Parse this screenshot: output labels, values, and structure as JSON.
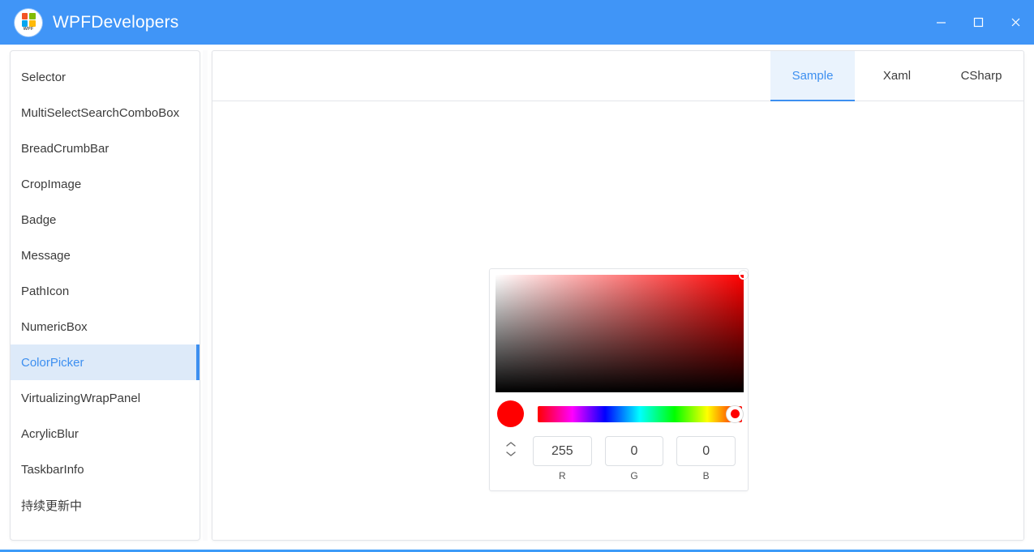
{
  "window": {
    "title": "WPFDevelopers",
    "logo_text": "WPF",
    "logo_colors": [
      "#f35325",
      "#81bc06",
      "#05a6f0",
      "#ffba08"
    ],
    "titlebar_color": "#4095f7",
    "controls": [
      {
        "name": "minimize",
        "glyph": "minimize-icon"
      },
      {
        "name": "maximize",
        "glyph": "maximize-icon"
      },
      {
        "name": "close",
        "glyph": "close-icon"
      }
    ]
  },
  "sidebar": {
    "items": [
      {
        "label": "Selector",
        "active": false
      },
      {
        "label": "MultiSelectSearchComboBox",
        "active": false
      },
      {
        "label": "BreadCrumbBar",
        "active": false
      },
      {
        "label": "CropImage",
        "active": false
      },
      {
        "label": "Badge",
        "active": false
      },
      {
        "label": "Message",
        "active": false
      },
      {
        "label": "PathIcon",
        "active": false
      },
      {
        "label": "NumericBox",
        "active": false
      },
      {
        "label": "ColorPicker",
        "active": true
      },
      {
        "label": "VirtualizingWrapPanel",
        "active": false
      },
      {
        "label": "AcrylicBlur",
        "active": false
      },
      {
        "label": "TaskbarInfo",
        "active": false
      },
      {
        "label": "持续更新中",
        "active": false
      }
    ],
    "active_color": "#3d8ff0",
    "active_background": "#ddeaf9"
  },
  "content": {
    "tabs": [
      {
        "label": "Sample",
        "active": true
      },
      {
        "label": "Xaml",
        "active": false
      },
      {
        "label": "CSharp",
        "active": false
      }
    ],
    "accent_color": "#3d8ff0"
  },
  "color_picker": {
    "selected_color": "#ff0000",
    "hue_degrees": 360,
    "saturation": 100,
    "value": 100,
    "channels": [
      {
        "label": "R",
        "value": "255"
      },
      {
        "label": "G",
        "value": "0"
      },
      {
        "label": "B",
        "value": "0"
      }
    ],
    "spinner_up": "chevron-up-icon",
    "spinner_down": "chevron-down-icon"
  }
}
